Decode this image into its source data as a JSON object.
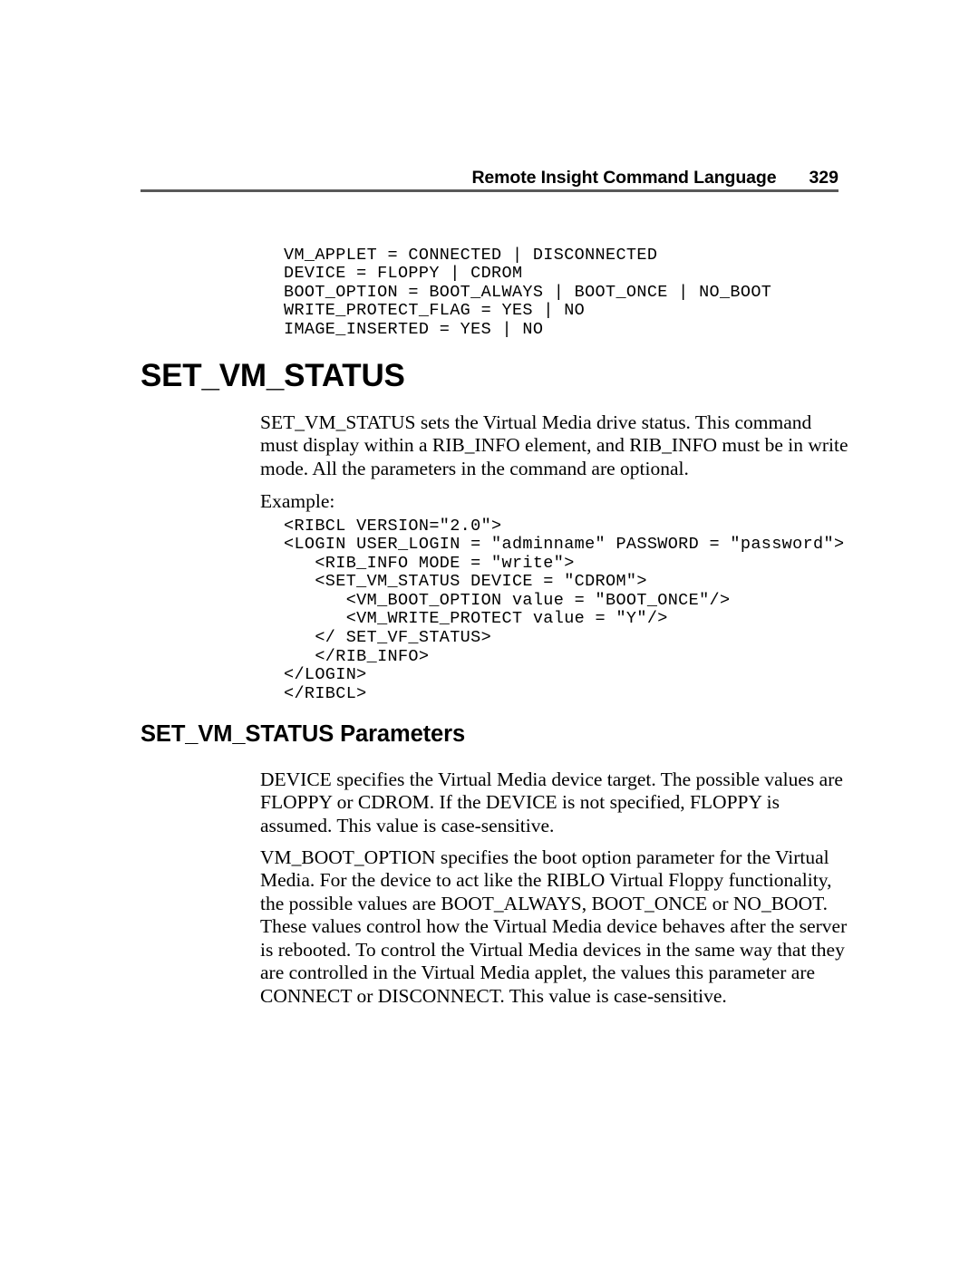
{
  "header": {
    "title": "Remote Insight Command Language",
    "page_number": "329",
    "rule_color": "#595959"
  },
  "syntax_block": "VM_APPLET = CONNECTED | DISCONNECTED\nDEVICE = FLOPPY | CDROM\nBOOT_OPTION = BOOT_ALWAYS | BOOT_ONCE | NO_BOOT\nWRITE_PROTECT_FLAG = YES | NO\nIMAGE_INSERTED = YES | NO",
  "headings": {
    "main": "SET_VM_STATUS",
    "parameters": "SET_VM_STATUS Parameters"
  },
  "paragraphs": {
    "intro": "SET_VM_STATUS sets the Virtual Media drive status. This command must display within a RIB_INFO element, and RIB_INFO must be in write mode. All the parameters in the command are optional.",
    "example_label": "Example:",
    "device": "DEVICE specifies the Virtual Media device target.  The possible values are FLOPPY or CDROM. If the DEVICE is not specified, FLOPPY is assumed. This value is case-sensitive.",
    "boot_option": "VM_BOOT_OPTION specifies the boot option parameter for the Virtual Media. For the device to act like the RIBLO Virtual Floppy functionality, the possible values are BOOT_ALWAYS, BOOT_ONCE or NO_BOOT. These values control how the Virtual Media device behaves after the server is rebooted. To control the Virtual Media devices in the same way that they are controlled in the Virtual Media applet, the values this parameter are CONNECT or DISCONNECT. This value is case-sensitive."
  },
  "example_block": "<RIBCL VERSION=\"2.0\">\n<LOGIN USER_LOGIN = \"adminname\" PASSWORD = \"password\">\n   <RIB_INFO MODE = \"write\">\n   <SET_VM_STATUS DEVICE = \"CDROM\">\n      <VM_BOOT_OPTION value = \"BOOT_ONCE\"/>\n      <VM_WRITE_PROTECT value = \"Y\"/>\n   </ SET_VF_STATUS>\n   </RIB_INFO>\n</LOGIN>\n</RIBCL>"
}
